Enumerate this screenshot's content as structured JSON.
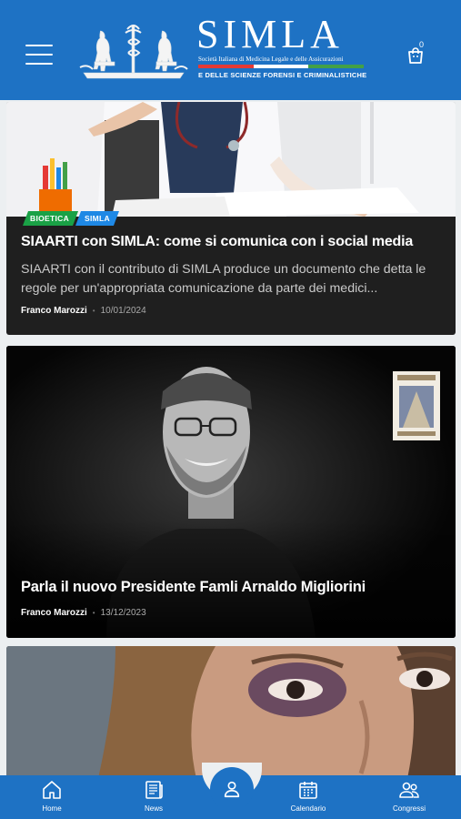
{
  "header": {
    "logo_title": "SIMLA",
    "logo_subtitle": "Società Italiana di Medicina Legale e delle Assicurazioni",
    "logo_tagline": "E DELLE SCIENZE FORENSI E CRIMINALISTICHE",
    "cart_count": "0",
    "colors": {
      "bar": "#1e72c4",
      "stripe": [
        "#e53935",
        "#ffffff",
        "#43a047"
      ]
    }
  },
  "articles": [
    {
      "tags": [
        "BIOETICA",
        "SIMLA"
      ],
      "title": "SIAARTI con SIMLA: come si comunica con i social media",
      "excerpt": "SIAARTI con il contributo di SIMLA produce un documento che detta le regole per un'appropriata comunicazione da parte dei medici...",
      "author": "Franco Marozzi",
      "date": "10/01/2024"
    },
    {
      "title": "Parla il nuovo Presidente Famli Arnaldo Migliorini",
      "author": "Franco Marozzi",
      "date": "13/12/2023"
    },
    {
      "title": ""
    }
  ],
  "bottom_nav": {
    "items": [
      {
        "label": "Home",
        "icon": "home-icon"
      },
      {
        "label": "News",
        "icon": "news-icon"
      },
      {
        "label": "Calendario",
        "icon": "calendar-icon"
      },
      {
        "label": "Congressi",
        "icon": "people-icon"
      }
    ],
    "center_icon": "user-icon"
  }
}
